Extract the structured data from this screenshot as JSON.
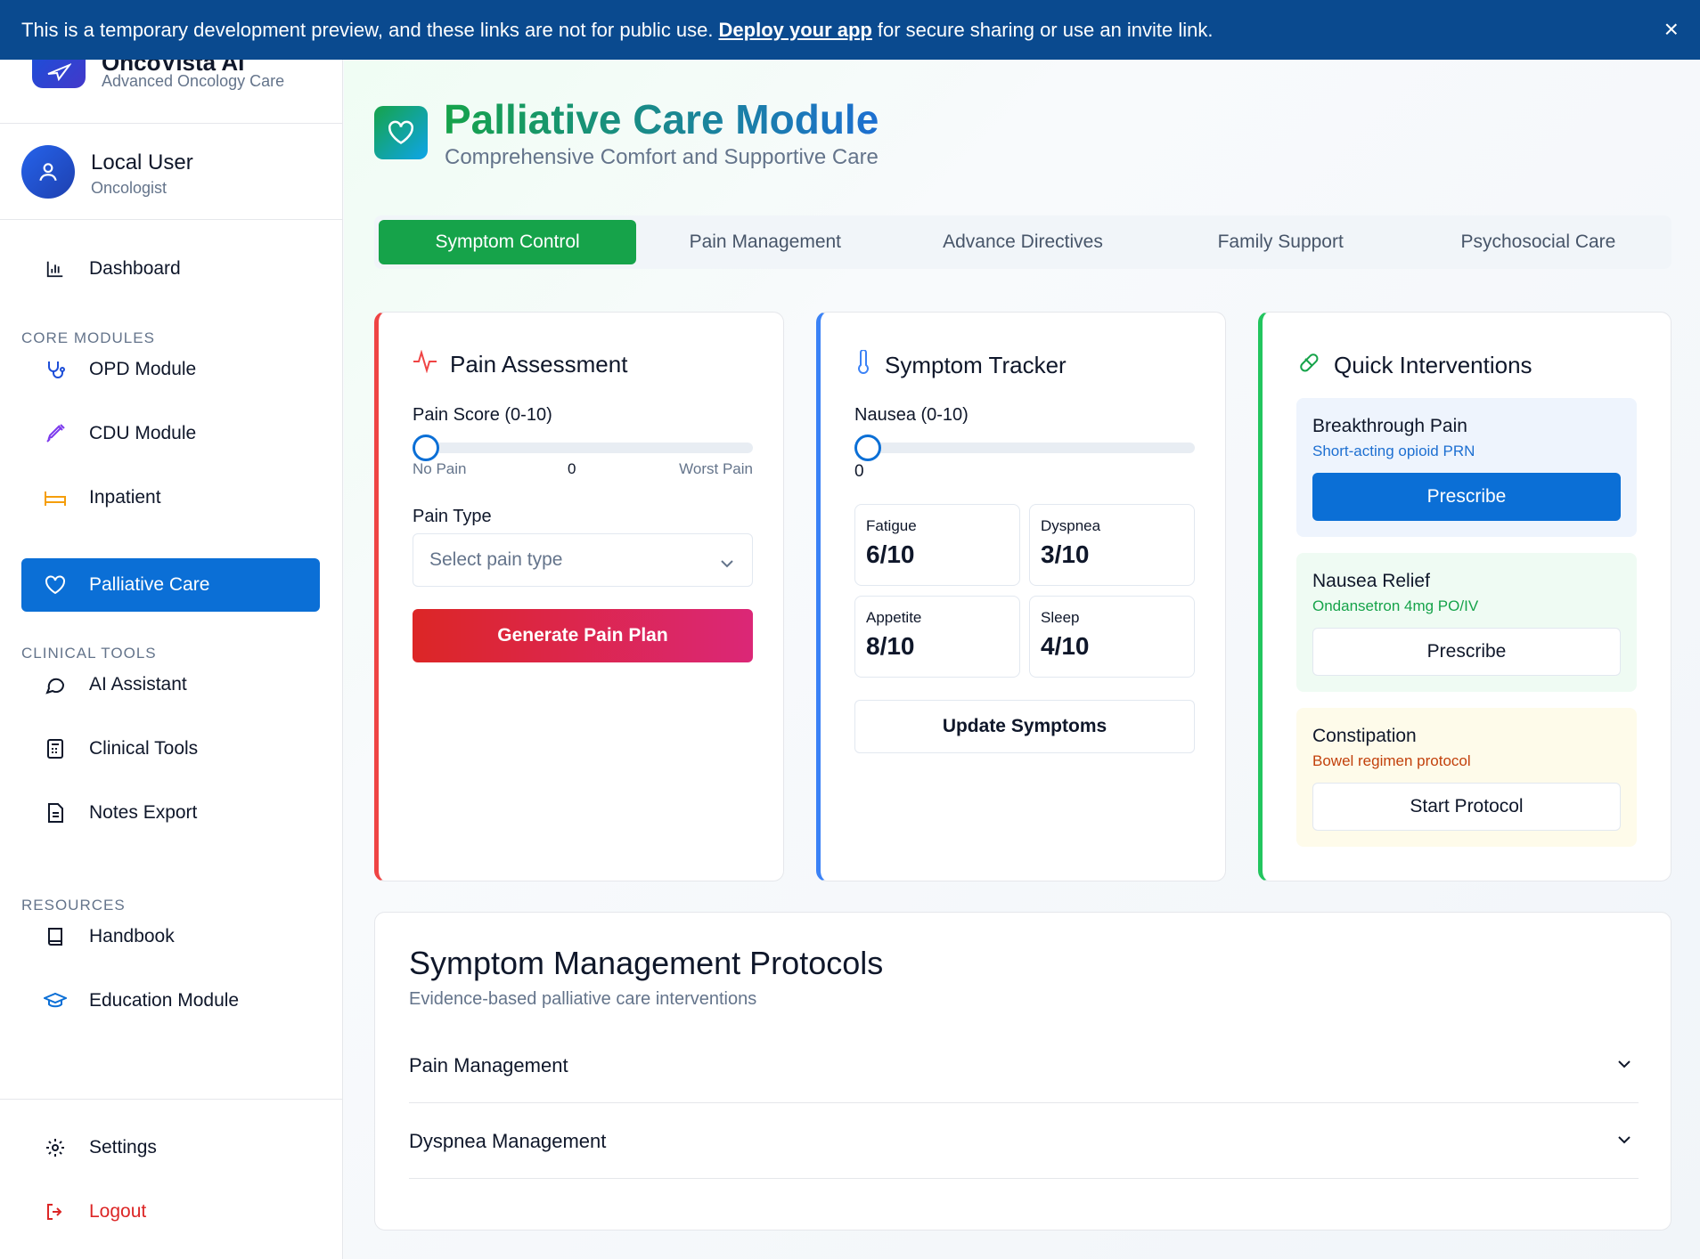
{
  "banner": {
    "text_before": "This is a temporary development preview, and these links are not for public use.",
    "link": "Deploy your app",
    "text_after": "for secure sharing or use an invite link.",
    "close": "×"
  },
  "brand": {
    "name": "OncoVista AI",
    "subtitle": "Advanced Oncology Care"
  },
  "user": {
    "name": "Local User",
    "role": "Oncologist"
  },
  "sidebar": {
    "dashboard": "Dashboard",
    "core_label": "CORE MODULES",
    "core": [
      "OPD Module",
      "CDU Module",
      "Inpatient",
      "Palliative Care"
    ],
    "clinical_label": "CLINICAL TOOLS",
    "clinical": [
      "AI Assistant",
      "Clinical Tools",
      "Notes Export"
    ],
    "resources_label": "RESOURCES",
    "resources": [
      "Handbook",
      "Education Module"
    ],
    "settings": "Settings",
    "logout": "Logout"
  },
  "header": {
    "title": "Palliative Care Module",
    "subtitle": "Comprehensive Comfort and Supportive Care"
  },
  "tabs": [
    "Symptom Control",
    "Pain Management",
    "Advance Directives",
    "Family Support",
    "Psychosocial Care"
  ],
  "pain": {
    "title": "Pain Assessment",
    "score_label": "Pain Score (0-10)",
    "score_value": 0,
    "min_label": "No Pain",
    "value_text": "0",
    "max_label": "Worst Pain",
    "type_label": "Pain Type",
    "type_placeholder": "Select pain type",
    "generate": "Generate Pain Plan"
  },
  "symptoms": {
    "title": "Symptom Tracker",
    "nausea_label": "Nausea (0-10)",
    "nausea_value": 0,
    "nausea_text": "0",
    "stats": [
      {
        "label": "Fatigue",
        "value": "6/10"
      },
      {
        "label": "Dyspnea",
        "value": "3/10"
      },
      {
        "label": "Appetite",
        "value": "8/10"
      },
      {
        "label": "Sleep",
        "value": "4/10"
      }
    ],
    "update": "Update Symptoms"
  },
  "interventions": {
    "title": "Quick Interventions",
    "items": [
      {
        "title": "Breakthrough Pain",
        "sub": "Short-acting opioid PRN",
        "button": "Prescribe"
      },
      {
        "title": "Nausea Relief",
        "sub": "Ondansetron 4mg PO/IV",
        "button": "Prescribe"
      },
      {
        "title": "Constipation",
        "sub": "Bowel regimen protocol",
        "button": "Start Protocol"
      }
    ]
  },
  "protocols": {
    "title": "Symptom Management Protocols",
    "subtitle": "Evidence-based palliative care interventions",
    "items": [
      "Pain Management",
      "Dyspnea Management"
    ]
  },
  "colors": {
    "primary": "#0b6fd6",
    "green": "#16a34a",
    "red": "#ef4444",
    "blue": "#3b82f6"
  }
}
